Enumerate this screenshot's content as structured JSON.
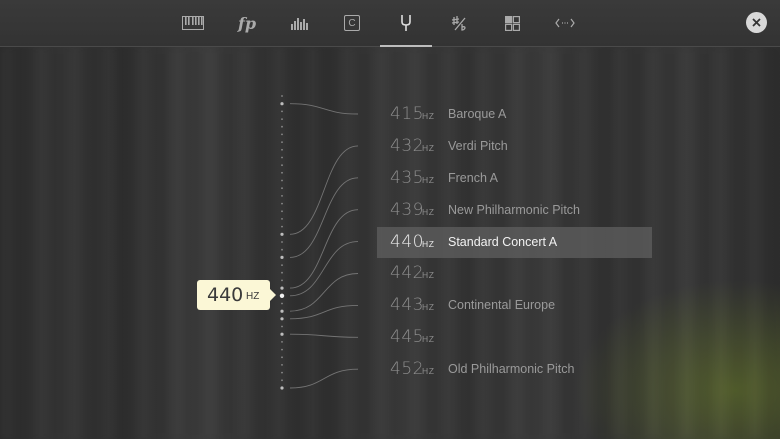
{
  "toolbar": {
    "tools": [
      {
        "name": "keyboard-icon"
      },
      {
        "name": "dynamics-icon",
        "label": "fp"
      },
      {
        "name": "equalizer-icon"
      },
      {
        "name": "chord-icon",
        "label": "C"
      },
      {
        "name": "tuning-fork-icon",
        "active": true
      },
      {
        "name": "transpose-icon"
      },
      {
        "name": "layout-icon"
      },
      {
        "name": "range-icon"
      }
    ],
    "close": {
      "name": "close-icon"
    }
  },
  "tuning": {
    "selected": {
      "value": "440",
      "unit": "HZ"
    },
    "pitches": [
      {
        "value": "415",
        "unit": "HZ",
        "label": "Baroque A"
      },
      {
        "value": "432",
        "unit": "HZ",
        "label": "Verdi Pitch"
      },
      {
        "value": "435",
        "unit": "HZ",
        "label": "French A"
      },
      {
        "value": "439",
        "unit": "HZ",
        "label": "New Philharmonic Pitch"
      },
      {
        "value": "440",
        "unit": "HZ",
        "label": "Standard Concert A",
        "selected": true
      },
      {
        "value": "442",
        "unit": "HZ",
        "label": ""
      },
      {
        "value": "443",
        "unit": "HZ",
        "label": "Continental Europe"
      },
      {
        "value": "445",
        "unit": "HZ",
        "label": ""
      },
      {
        "value": "452",
        "unit": "HZ",
        "label": "Old Philharmonic Pitch"
      }
    ]
  },
  "colors": {
    "badge": "#fbf7d6",
    "selected_row": "#5f5f5f",
    "accent": "#e8e8e8"
  }
}
